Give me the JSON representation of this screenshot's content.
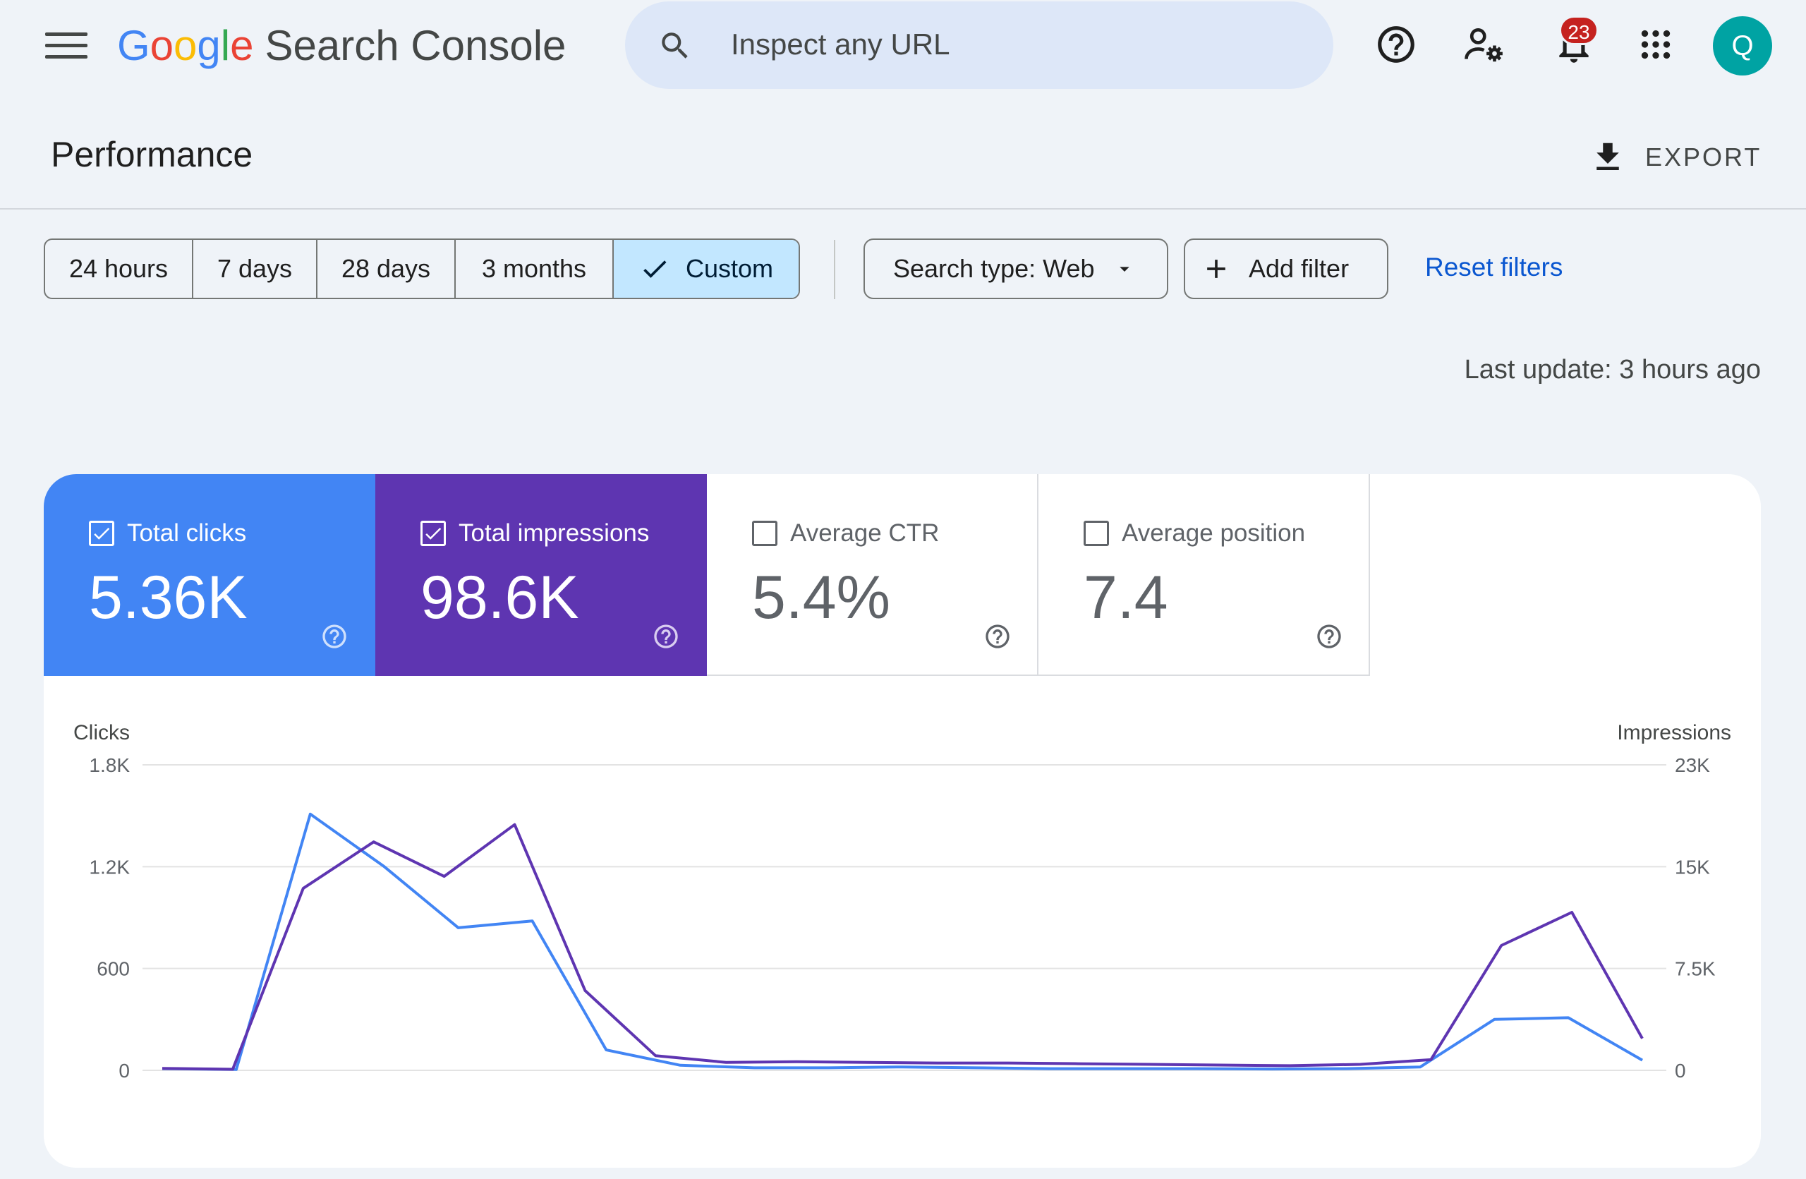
{
  "header": {
    "logo_letters": [
      "G",
      "o",
      "o",
      "g",
      "l",
      "e"
    ],
    "product_name": "Search Console",
    "search_placeholder": "Inspect any URL",
    "notification_count": "23",
    "avatar_initial": "Q"
  },
  "page": {
    "title": "Performance",
    "export_label": "EXPORT"
  },
  "filters": {
    "date_ranges": [
      "24 hours",
      "7 days",
      "28 days",
      "3 months",
      "Custom"
    ],
    "active_range": "Custom",
    "search_type_label": "Search type: Web",
    "add_filter_label": "Add filter",
    "reset_label": "Reset filters",
    "last_update": "Last update: 3 hours ago"
  },
  "metrics": [
    {
      "label": "Total clicks",
      "value": "5.36K",
      "checked": true,
      "color": "#4285f4"
    },
    {
      "label": "Total impressions",
      "value": "98.6K",
      "checked": true,
      "color": "#5e35b1"
    },
    {
      "label": "Average CTR",
      "value": "5.4%",
      "checked": false,
      "color": "#ffffff"
    },
    {
      "label": "Average position",
      "value": "7.4",
      "checked": false,
      "color": "#ffffff"
    }
  ],
  "chart_data": {
    "type": "line",
    "left_axis_label": "Clicks",
    "right_axis_label": "Impressions",
    "left_ticks": [
      "1.8K",
      "1.2K",
      "600",
      "0"
    ],
    "right_ticks": [
      "23K",
      "15K",
      "7.5K",
      "0"
    ],
    "left_ylim": [
      0,
      1800
    ],
    "right_ylim": [
      0,
      23000
    ],
    "grid": true,
    "series": [
      {
        "axis": "left",
        "color": "#4285f4",
        "values": [
          10,
          5,
          1510,
          1200,
          840,
          880,
          120,
          30,
          15,
          15,
          20,
          15,
          10,
          10,
          10,
          8,
          10,
          20,
          300,
          310,
          60
        ]
      },
      {
        "axis": "right",
        "color": "#5e35b1",
        "values": [
          150,
          80,
          13700,
          17200,
          14600,
          18500,
          6000,
          1100,
          600,
          650,
          600,
          550,
          550,
          500,
          450,
          400,
          350,
          450,
          800,
          9400,
          11900,
          2400
        ]
      }
    ]
  }
}
